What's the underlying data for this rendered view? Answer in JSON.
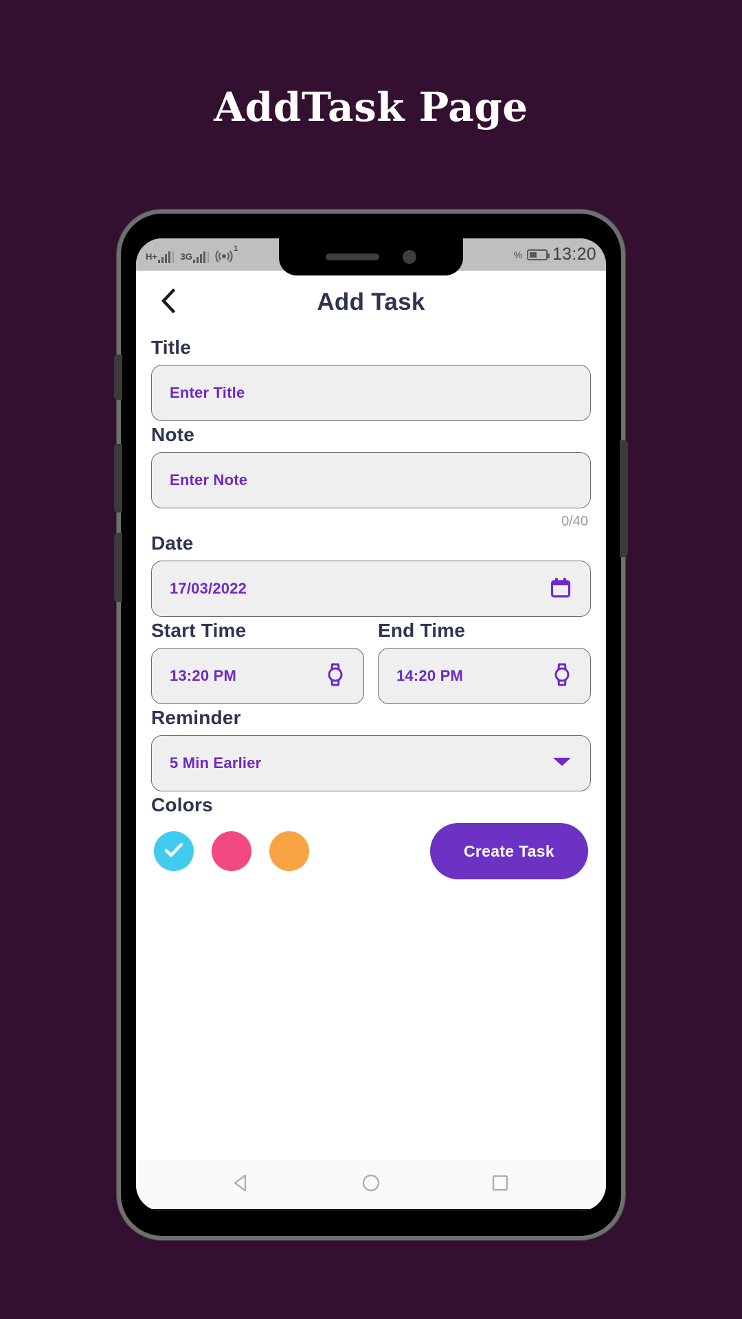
{
  "page": {
    "title": "AddTask Page",
    "background_color": "#341030"
  },
  "status_bar": {
    "network_1_label": "H+",
    "network_2_label": "3G",
    "hotspot_icon": "hotspot-icon",
    "hotspot_badge": "1",
    "battery_percent_glyph": "%",
    "battery_icon": "battery-icon",
    "time": "13:20"
  },
  "app_bar": {
    "back_icon": "chevron-left-icon",
    "title": "Add Task"
  },
  "form": {
    "title": {
      "label": "Title",
      "value": "",
      "placeholder": "Enter Title"
    },
    "note": {
      "label": "Note",
      "value": "",
      "placeholder": "Enter Note",
      "counter": "0/40"
    },
    "date": {
      "label": "Date",
      "value": "17/03/2022",
      "icon": "calendar-icon"
    },
    "start_time": {
      "label": "Start Time",
      "value": "13:20 PM",
      "icon": "watch-icon"
    },
    "end_time": {
      "label": "End Time",
      "value": "14:20 PM",
      "icon": "watch-icon"
    },
    "reminder": {
      "label": "Reminder",
      "value": "5 Min Earlier",
      "icon": "chevron-down-icon"
    },
    "colors": {
      "label": "Colors",
      "swatches": [
        {
          "name": "blue",
          "hex": "#41ccef",
          "selected": true
        },
        {
          "name": "pink",
          "hex": "#f24a80",
          "selected": false
        },
        {
          "name": "orange",
          "hex": "#f9a444",
          "selected": false
        }
      ]
    },
    "submit": {
      "label": "Create Task",
      "color": "#6b32c3"
    }
  },
  "nav_bar": {
    "back_icon": "triangle-back-icon",
    "home_icon": "circle-home-icon",
    "recents_icon": "square-recents-icon"
  },
  "theme": {
    "accent_purple": "#6f29c9",
    "text_dark": "#2e3450",
    "field_bg": "#efefef"
  }
}
